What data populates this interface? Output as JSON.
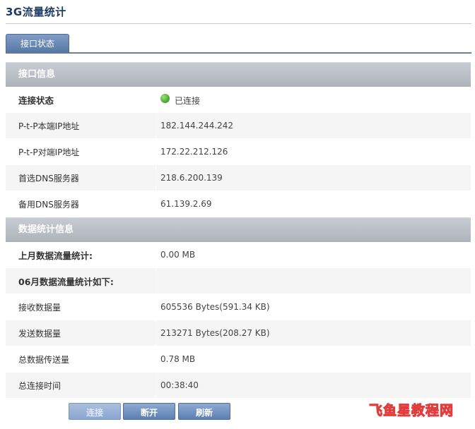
{
  "page": {
    "title": "3G流量统计"
  },
  "tabs": [
    {
      "label": "接口状态",
      "active": true
    }
  ],
  "interface_info": {
    "header": "接口信息",
    "rows": [
      {
        "label": "连接状态",
        "value": "已连接"
      },
      {
        "label": "P-t-P本端IP地址",
        "value": "182.144.244.242"
      },
      {
        "label": "P-t-P对端IP地址",
        "value": "172.22.212.126"
      },
      {
        "label": "首选DNS服务器",
        "value": "218.6.200.139"
      },
      {
        "label": "备用DNS服务器",
        "value": "61.139.2.69"
      }
    ]
  },
  "stats_info": {
    "header": "数据统计信息",
    "rows": [
      {
        "label": "上月数据流量统计:",
        "value": "0.00 MB"
      },
      {
        "label": "06月数据流量统计如下:",
        "value": ""
      },
      {
        "label": "接收数据量",
        "value": "605536 Bytes(591.34 KB)"
      },
      {
        "label": "发送数据量",
        "value": "213271 Bytes(208.27 KB)"
      },
      {
        "label": "总数据传送量",
        "value": "0.78 MB"
      },
      {
        "label": "总连接时间",
        "value": "00:38:40"
      }
    ]
  },
  "buttons": {
    "connect": "连接",
    "disconnect": "断开",
    "refresh": "刷新"
  },
  "watermark": {
    "text": "飞鱼星教程网"
  },
  "colors": {
    "section_header": "#aeb3ba",
    "tab": "#5777a4",
    "button": "#5d7fb0",
    "status_connected": "#3fa326",
    "watermark": "#e23c3c"
  },
  "icons": {
    "status": "status-connected-icon"
  }
}
